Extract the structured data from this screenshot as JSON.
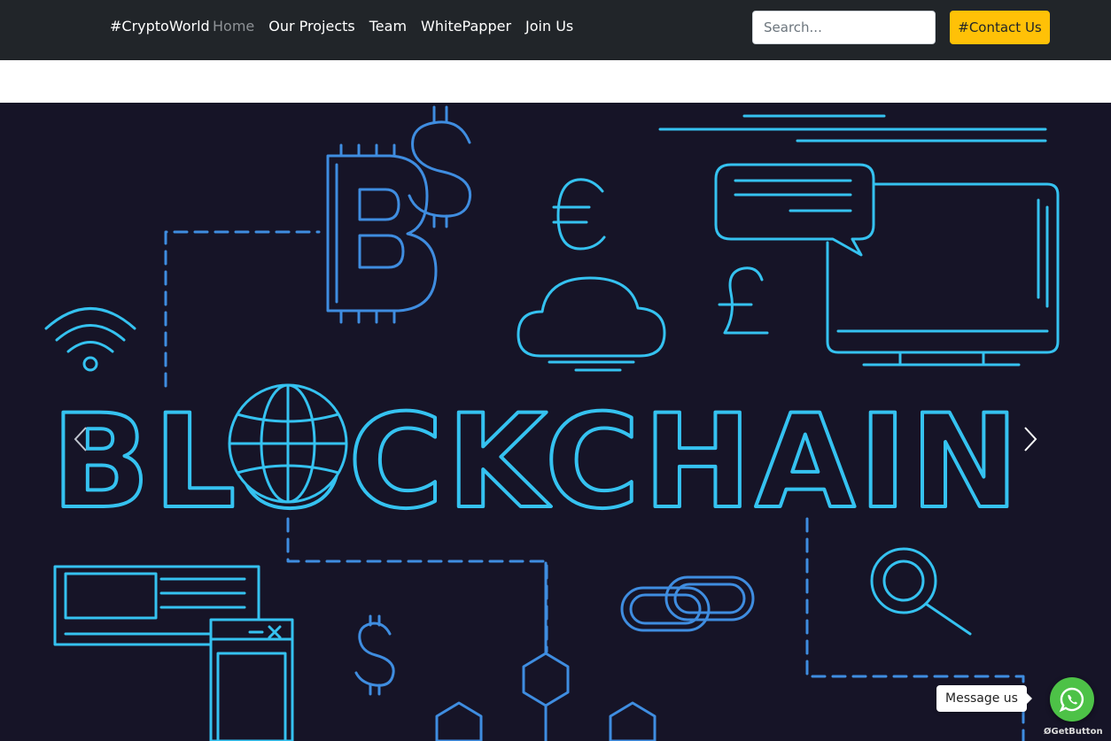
{
  "navbar": {
    "brand": "#CryptoWorld",
    "links": [
      {
        "label": "Home",
        "active": true
      },
      {
        "label": "Our Projects"
      },
      {
        "label": "Team"
      },
      {
        "label": "WhitePapper"
      },
      {
        "label": "Join Us"
      }
    ],
    "search_placeholder": "Search...",
    "contact_label": "#Contact Us"
  },
  "hero": {
    "headline": "BLOCKCHAIN",
    "icons": [
      "bitcoin-icon",
      "dollar-icon",
      "euro-icon",
      "pound-icon",
      "cloud-icon",
      "chat-bubble-icon",
      "monitor-icon",
      "wifi-icon",
      "globe-icon",
      "magnifier-icon",
      "chain-link-icon",
      "browser-window-icon",
      "hexagon-node-icon"
    ]
  },
  "chat_widget": {
    "bubble_text": "Message us",
    "credit": "GetButton"
  },
  "colors": {
    "navbar_bg": "#212529",
    "accent": "#ffc107",
    "hero_bg": "#161427",
    "neon": "#35c2f0",
    "whatsapp": "#4dc247"
  }
}
